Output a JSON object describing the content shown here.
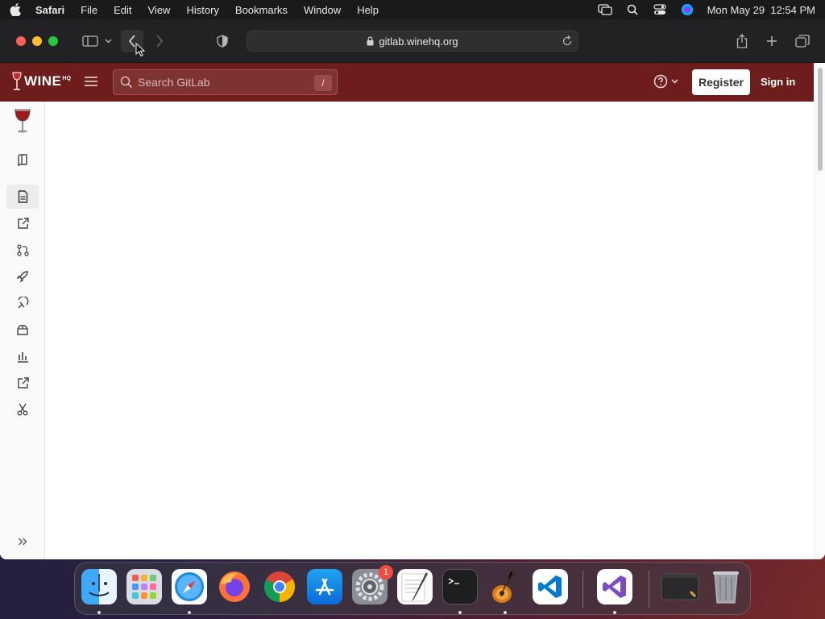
{
  "menubar": {
    "app_name": "Safari",
    "items": [
      "File",
      "Edit",
      "View",
      "History",
      "Bookmarks",
      "Window",
      "Help"
    ],
    "clock": "Mon May 29  12:54 PM"
  },
  "browser": {
    "url": "gitlab.winehq.org"
  },
  "gitlab": {
    "logo_text": "WINE",
    "logo_sup": "HQ",
    "search_placeholder": "Search GitLab",
    "search_shortcut": "/",
    "register_label": "Register",
    "signin_label": "Sign in"
  },
  "sidebar": {
    "items": [
      "repository-icon",
      "file-icon",
      "external-link-icon",
      "merge-request-icon",
      "rocket-icon",
      "monitor-icon",
      "package-icon",
      "analytics-icon",
      "external-link-icon",
      "snippet-icon"
    ],
    "active_index": 1
  },
  "dock": {
    "apps": [
      "Finder",
      "Launchpad",
      "Safari",
      "Firefox",
      "Chrome",
      "App Store",
      "System Settings",
      "TextEdit",
      "Terminal",
      "GarageBand",
      "VS Code",
      "Visual Studio",
      "Screenshot",
      "Trash"
    ],
    "settings_badge": "1"
  }
}
